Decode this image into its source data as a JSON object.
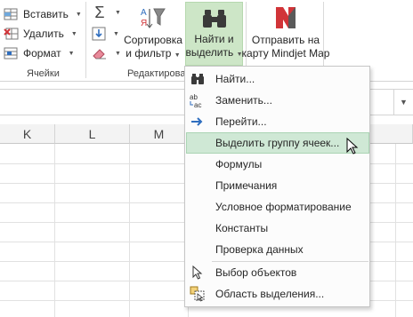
{
  "ribbon": {
    "cells_group": {
      "label": "Ячейки",
      "insert": "Вставить",
      "delete": "Удалить",
      "format": "Формат"
    },
    "editing_group": {
      "label": "Редактирова",
      "sort_filter": [
        "Сортировка",
        "и фильтр"
      ],
      "find_select": [
        "Найти и",
        "выделить"
      ]
    },
    "mindjet": {
      "label": [
        "Отправить на",
        "карту Mindjet Map"
      ]
    }
  },
  "columns": [
    "K",
    "L",
    "M"
  ],
  "menu": {
    "items": [
      {
        "label": "Найти...",
        "icon": "binoculars-icon"
      },
      {
        "label": "Заменить...",
        "icon": "replace-icon"
      },
      {
        "label": "Перейти...",
        "icon": "arrow-right-icon"
      },
      {
        "label": "Выделить группу ячеек...",
        "icon": "none",
        "highlighted": true
      },
      {
        "label": "Формулы",
        "icon": "none"
      },
      {
        "label": "Примечания",
        "icon": "none"
      },
      {
        "label": "Условное форматирование",
        "icon": "none"
      },
      {
        "label": "Константы",
        "icon": "none"
      },
      {
        "label": "Проверка данных",
        "icon": "none"
      },
      {
        "label": "Выбор объектов",
        "icon": "select-pointer-icon"
      },
      {
        "label": "Область выделения...",
        "icon": "selection-pane-icon"
      }
    ]
  },
  "colors": {
    "accent_green": "#cde6c7",
    "highlight": "#cfe8d5",
    "blue": "#2f6ebf",
    "red": "#d13438"
  }
}
